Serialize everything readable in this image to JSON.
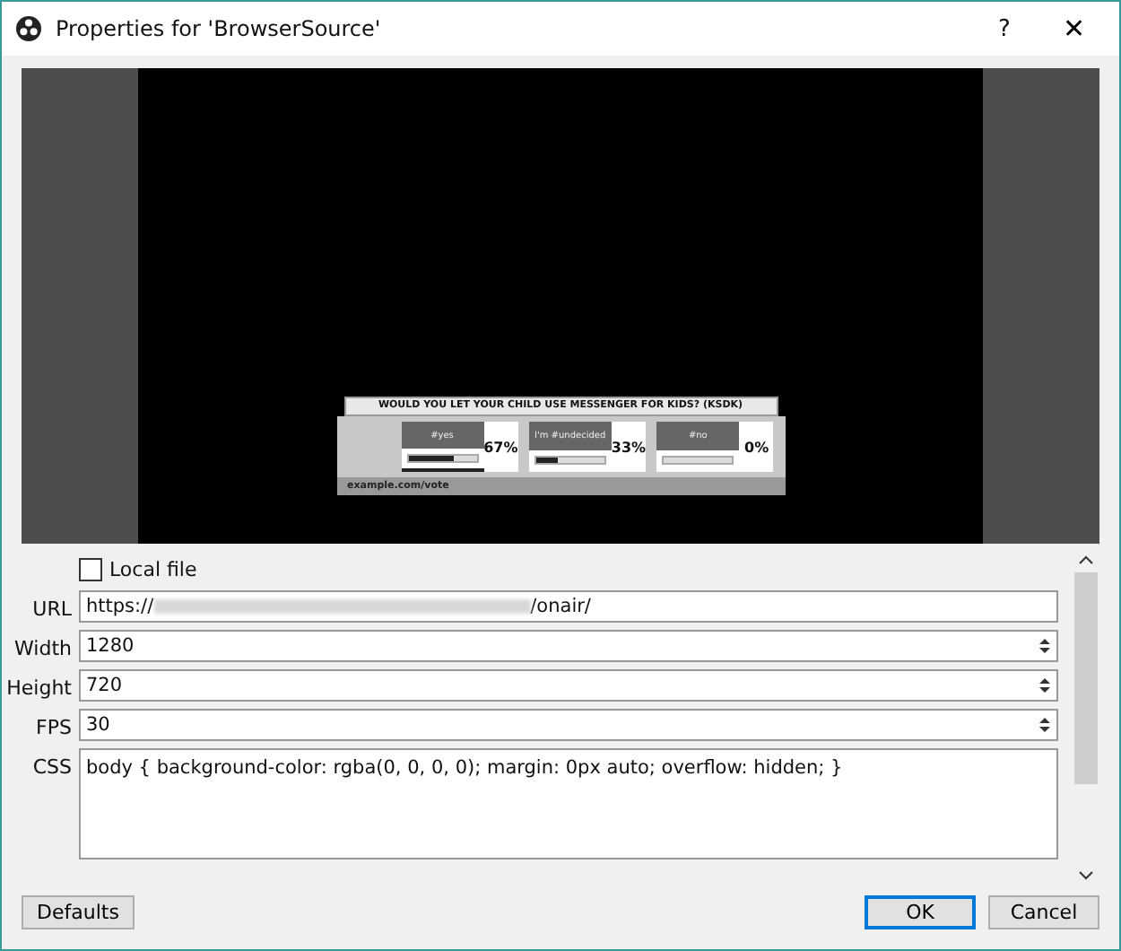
{
  "window": {
    "title": "Properties for 'BrowserSource'",
    "help": "?",
    "close": "✕"
  },
  "preview": {
    "poll": {
      "question": "WOULD YOU LET YOUR CHILD  USE MESSENGER FOR KIDS? (KSDK)",
      "footer": "example.com/vote",
      "options": [
        {
          "label": "#yes",
          "percent": "67%",
          "level": 0.67,
          "selected": true
        },
        {
          "label": "I'm #undecided",
          "percent": "33%",
          "level": 0.33,
          "selected": false
        },
        {
          "label": "#no",
          "percent": "0%",
          "level": 0,
          "selected": false
        }
      ]
    }
  },
  "form": {
    "local_file": {
      "label": "Local file",
      "checked": false
    },
    "fields": [
      {
        "kind": "url",
        "label": "URL",
        "prefix": "https://",
        "suffix": "/onair/"
      },
      {
        "kind": "spin",
        "label": "Width",
        "value": "1280"
      },
      {
        "kind": "spin",
        "label": "Height",
        "value": "720"
      },
      {
        "kind": "spin",
        "label": "FPS",
        "value": "30"
      },
      {
        "kind": "text",
        "label": "CSS",
        "value": "body { background-color: rgba(0, 0, 0, 0); margin: 0px auto; overflow: hidden; }"
      }
    ]
  },
  "buttons": {
    "defaults": "Defaults",
    "ok": "OK",
    "cancel": "Cancel"
  }
}
